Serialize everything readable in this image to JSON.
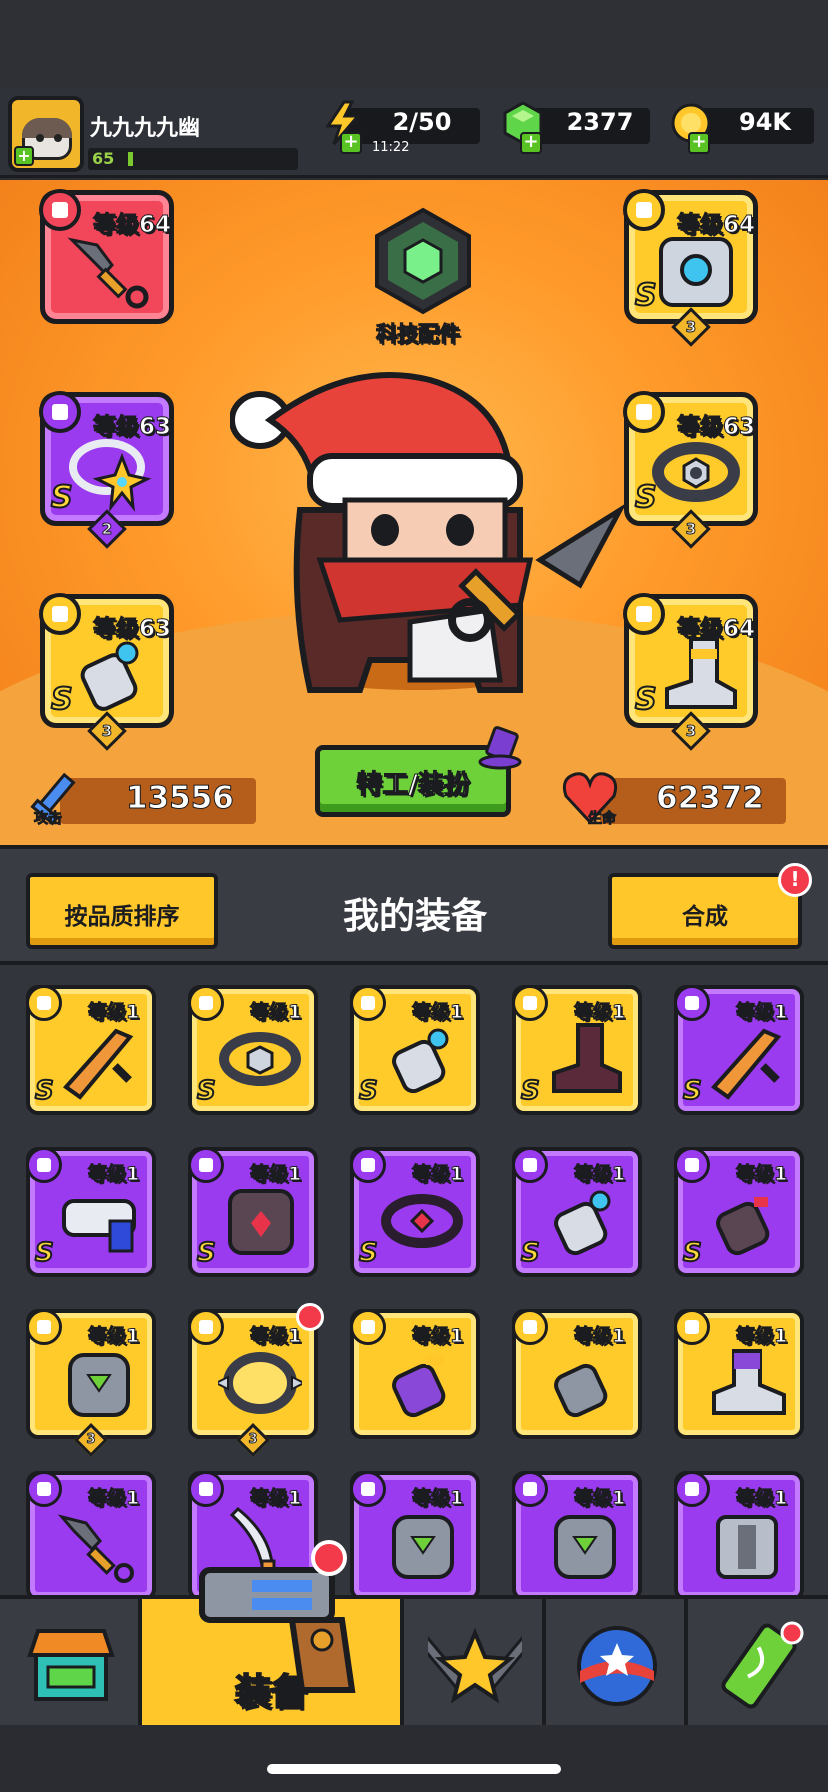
{
  "player": {
    "name": "九九九九幽",
    "level": "65",
    "level_progress": 0.03
  },
  "resources": {
    "energy": {
      "value": "2/50",
      "timer": "11:22",
      "icon": "lightning-icon"
    },
    "gems": {
      "value": "2377",
      "icon": "green-gem-icon"
    },
    "coins": {
      "value": "94K",
      "icon": "gold-coin-icon"
    }
  },
  "colors": {
    "stage": "#ff9a2a",
    "legendary": "#ffcb2a",
    "epic": "#9b3bf0",
    "mythic": "#f2465a",
    "accent_green": "#6fd13a"
  },
  "equipped": {
    "weapon": {
      "level": "等级64",
      "rarity": "mythic",
      "icon": "kunai-icon"
    },
    "armor": {
      "level": "等级64",
      "grade": "S",
      "stars": "3",
      "icon": "chest-armor-icon"
    },
    "necklace": {
      "level": "等级63",
      "grade": "S",
      "stars": "2",
      "icon": "star-necklace-icon"
    },
    "belt": {
      "level": "等级63",
      "grade": "S",
      "stars": "3",
      "icon": "belt-icon"
    },
    "gloves": {
      "level": "等级63",
      "grade": "S",
      "stars": "3",
      "icon": "gauntlet-icon"
    },
    "boots": {
      "level": "等级64",
      "grade": "S",
      "stars": "3",
      "icon": "boots-icon"
    }
  },
  "tech": {
    "label": "科技配件",
    "icon": "tech-hexagon-icon"
  },
  "agent_button": "特工/装扮",
  "stats": {
    "attack_label": "攻击",
    "attack": "13556",
    "hp_label": "生命",
    "hp": "62372"
  },
  "toolbar": {
    "sort": "按品质排序",
    "title": "我的装备",
    "merge": "合成",
    "merge_alert": "!"
  },
  "inventory": [
    {
      "rarity": "gold",
      "level": "等级1",
      "grade": "S",
      "icon": "sword-icon"
    },
    {
      "rarity": "gold",
      "level": "等级1",
      "grade": "S",
      "icon": "belt-icon"
    },
    {
      "rarity": "gold",
      "level": "等级1",
      "grade": "S",
      "icon": "gauntlet-icon"
    },
    {
      "rarity": "gold",
      "level": "等级1",
      "grade": "S",
      "icon": "boots-icon"
    },
    {
      "rarity": "purple",
      "level": "等级1",
      "grade": "S",
      "icon": "sword-icon"
    },
    {
      "rarity": "purple",
      "level": "等级1",
      "grade": "S",
      "icon": "blaster-icon"
    },
    {
      "rarity": "purple",
      "level": "等级1",
      "grade": "S",
      "icon": "dark-armor-icon"
    },
    {
      "rarity": "purple",
      "level": "等级1",
      "grade": "S",
      "icon": "dark-belt-icon"
    },
    {
      "rarity": "purple",
      "level": "等级1",
      "grade": "S",
      "icon": "gauntlet-icon"
    },
    {
      "rarity": "purple",
      "level": "等级1",
      "grade": "S",
      "icon": "dark-gauntlet-icon"
    },
    {
      "rarity": "gold",
      "level": "等级1",
      "stars": "3",
      "icon": "stone-armor-icon"
    },
    {
      "rarity": "gold",
      "level": "等级1",
      "stars": "3",
      "icon": "spiked-collar-icon",
      "new": true
    },
    {
      "rarity": "gold",
      "level": "等级1",
      "icon": "purple-gauntlet-icon"
    },
    {
      "rarity": "gold",
      "level": "等级1",
      "icon": "steel-gauntlet-icon"
    },
    {
      "rarity": "gold",
      "level": "等级1",
      "icon": "sneaker-icon"
    },
    {
      "rarity": "purple",
      "level": "等级1",
      "icon": "kunai-icon"
    },
    {
      "rarity": "purple",
      "level": "等级1",
      "icon": "machete-icon"
    },
    {
      "rarity": "purple",
      "level": "等级1",
      "icon": "stone-armor-icon"
    },
    {
      "rarity": "purple",
      "level": "等级1",
      "icon": "stone-armor-icon"
    },
    {
      "rarity": "purple",
      "level": "等级1",
      "icon": "steel-vest-icon"
    }
  ],
  "nav": [
    {
      "id": "shop",
      "icon": "shop-icon"
    },
    {
      "id": "equipment",
      "label": "装备",
      "icon": "revolver-icon",
      "active": true
    },
    {
      "id": "battle",
      "icon": "crossed-swords-star-icon"
    },
    {
      "id": "pets",
      "icon": "star-orb-icon"
    },
    {
      "id": "dna",
      "icon": "dna-capsule-icon"
    }
  ]
}
